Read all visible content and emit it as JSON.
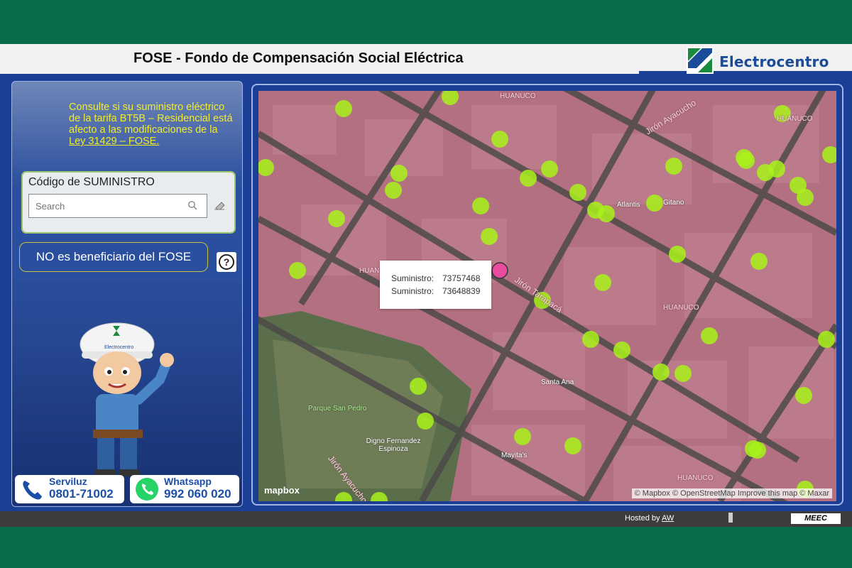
{
  "header": {
    "title": "FOSE - Fondo de Compensación Social Eléctrica",
    "logo_text": "Electrocentro"
  },
  "sidebar": {
    "intro_line1": "Consulte si su suministro eléctrico de la tarifa BT5B – Residencial está afecto a las modificaciones de la ",
    "intro_link": "Ley 31429 – FOSE.",
    "code_label": "Código de SUMINISTRO",
    "search_placeholder": "Search",
    "status_text": "NO es beneficiario del FOSE",
    "help_label": "?",
    "serviluz_label": "Serviluz",
    "serviluz_number": "0801-71002",
    "whatsapp_label": "Whatsapp",
    "whatsapp_number": "992 060 020",
    "mascot_cap_text": "Electrocentro"
  },
  "map": {
    "popup": {
      "rows": [
        {
          "label": "Suministro:",
          "value": "73757468"
        },
        {
          "label": "Suministro:",
          "value": "73648839"
        }
      ]
    },
    "labels": {
      "huanuco": "HUANUCO",
      "street1": "Jirón Ayacucho",
      "street2": "Jirón Tarapacá",
      "street3": "Jirón Ayacucho",
      "poi_atlantis": "Atlantis",
      "poi_gitano": "Gitano",
      "poi_santa_ana": "Santa Ana",
      "poi_parque": "Parque San Pedro",
      "poi_digno": "Digno Fernandez Espinoza",
      "poi_mayitas": "Mayita's"
    },
    "mapbox_logo": "mapbox",
    "attribution": "© Mapbox © OpenStreetMap  Improve this map © Maxar",
    "marker_color": "#a8f21a",
    "selected_color": "#e84aa0"
  },
  "footer": {
    "hosted_by": "Hosted by ",
    "hosted_link": "AW",
    "brand": "MEEC"
  }
}
